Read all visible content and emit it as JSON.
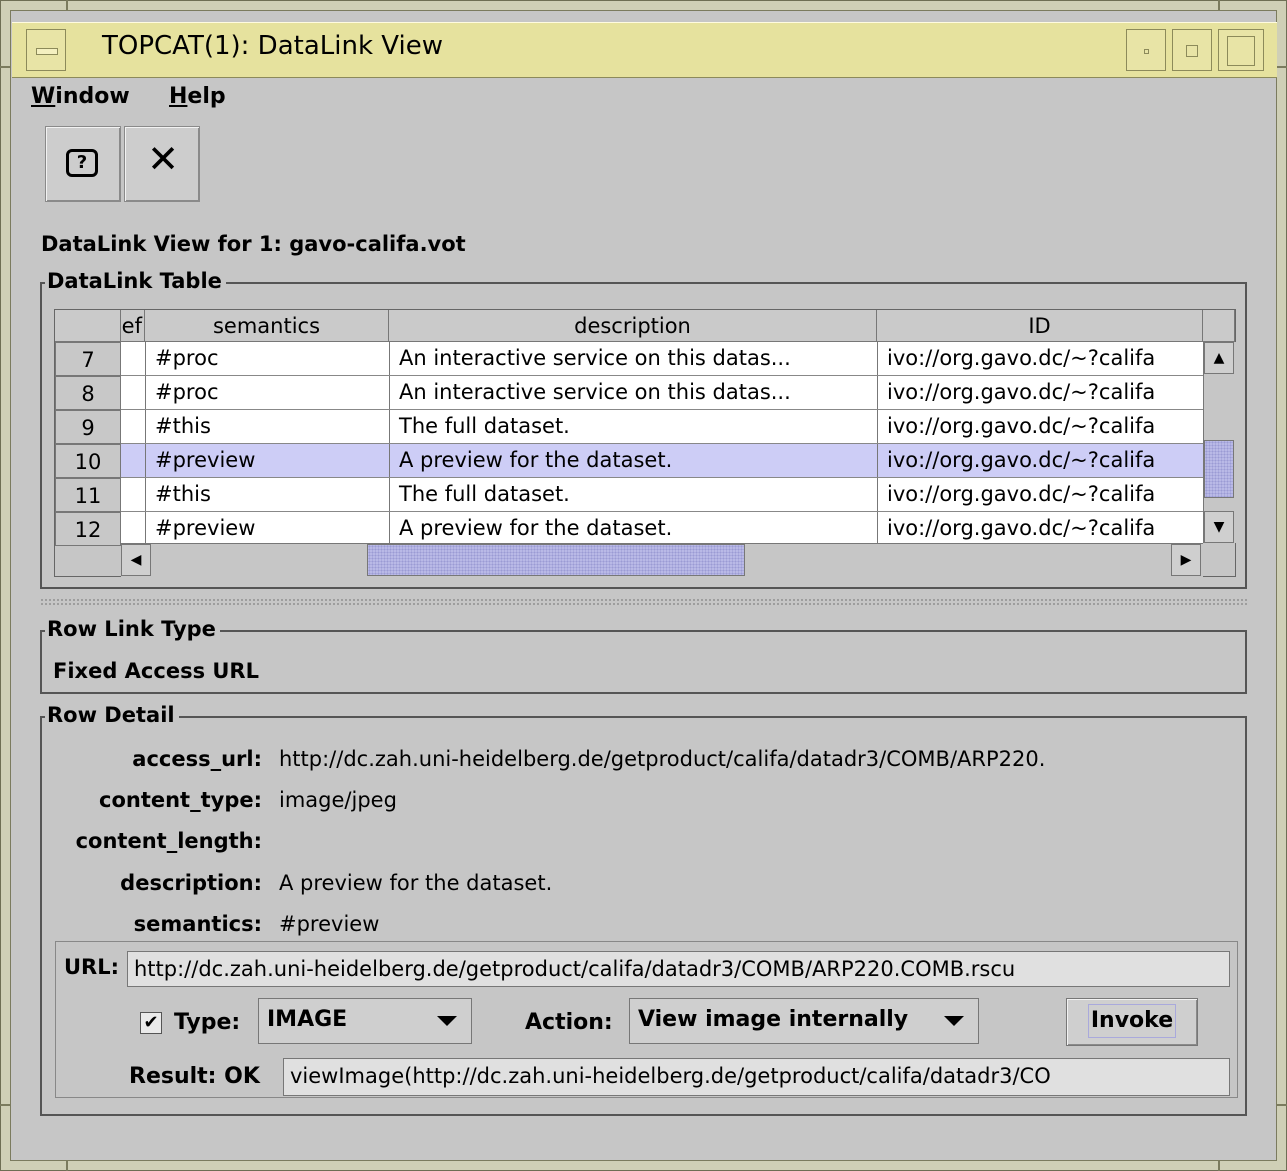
{
  "window": {
    "title": "TOPCAT(1): DataLink View"
  },
  "menu": {
    "window_label": "Window",
    "window_mnemonic": "W",
    "window_rest": "indow",
    "help_label": "Help",
    "help_mnemonic": "H",
    "help_rest": "elp"
  },
  "toolbar": {
    "help_glyph": "?",
    "close_glyph": "✕"
  },
  "view_heading": "DataLink View for 1: gavo-califa.vot",
  "datalink_table": {
    "legend": "DataLink Table",
    "columns": [
      "ef",
      "semantics",
      "description",
      "ID"
    ],
    "rows": [
      {
        "num": "7",
        "semantics": "#proc",
        "description": "An interactive service on this datas...",
        "id": "ivo://org.gavo.dc/~?califa",
        "selected": false
      },
      {
        "num": "8",
        "semantics": "#proc",
        "description": "An interactive service on this datas...",
        "id": "ivo://org.gavo.dc/~?califa",
        "selected": false
      },
      {
        "num": "9",
        "semantics": "#this",
        "description": "The full dataset.",
        "id": "ivo://org.gavo.dc/~?califa",
        "selected": false
      },
      {
        "num": "10",
        "semantics": "#preview",
        "description": "A preview for the dataset.",
        "id": "ivo://org.gavo.dc/~?califa",
        "selected": true
      },
      {
        "num": "11",
        "semantics": "#this",
        "description": "The full dataset.",
        "id": "ivo://org.gavo.dc/~?califa",
        "selected": false
      },
      {
        "num": "12",
        "semantics": "#preview",
        "description": "A preview for the dataset.",
        "id": "ivo://org.gavo.dc/~?califa",
        "selected": false
      }
    ]
  },
  "row_link_type": {
    "legend": "Row Link Type",
    "value": "Fixed Access URL"
  },
  "row_detail": {
    "legend": "Row Detail",
    "fields": [
      {
        "label": "access_url:",
        "value": "http://dc.zah.uni-heidelberg.de/getproduct/califa/datadr3/COMB/ARP220."
      },
      {
        "label": "content_type:",
        "value": "image/jpeg"
      },
      {
        "label": "content_length:",
        "value": ""
      },
      {
        "label": "description:",
        "value": "A preview for the dataset."
      },
      {
        "label": "semantics:",
        "value": "#preview"
      }
    ],
    "url_label": "URL:",
    "url_value": "http://dc.zah.uni-heidelberg.de/getproduct/califa/datadr3/COMB/ARP220.COMB.rscu",
    "type_checked": true,
    "type_label": "Type:",
    "type_value": "IMAGE",
    "action_label": "Action:",
    "action_value": "View image internally",
    "invoke_label": "Invoke",
    "result_label": "Result: OK",
    "result_value": "viewImage(http://dc.zah.uni-heidelberg.de/getproduct/califa/datadr3/CO"
  },
  "colors": {
    "titlebar": "#e6e29e",
    "selection": "#cdcdf6",
    "panel": "#c6c6c6"
  }
}
